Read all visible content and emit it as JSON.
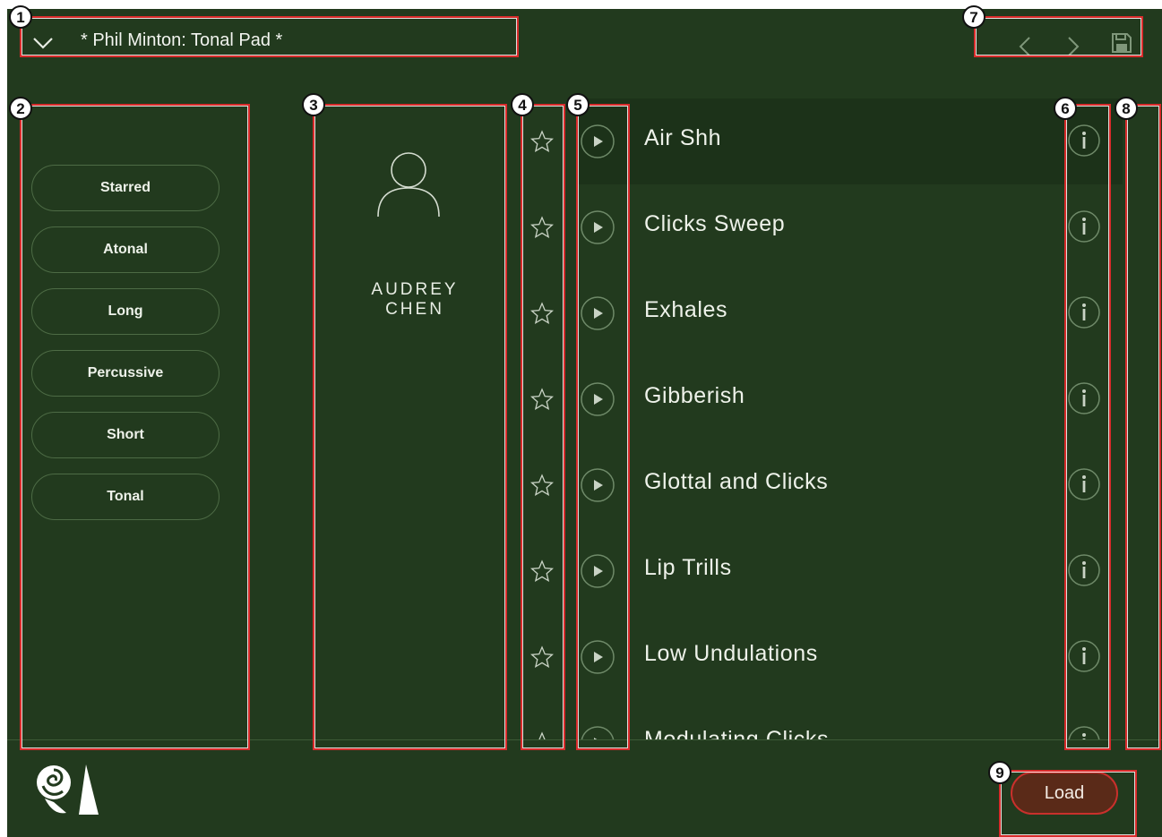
{
  "header": {
    "preset_title": "* Phil Minton: Tonal Pad *"
  },
  "tags": [
    "Starred",
    "Atonal",
    "Long",
    "Percussive",
    "Short",
    "Tonal"
  ],
  "author": {
    "line1": "AUDREY",
    "line2": "CHEN"
  },
  "presets": [
    {
      "name": "Air Shh",
      "selected": true
    },
    {
      "name": "Clicks Sweep",
      "selected": false
    },
    {
      "name": "Exhales",
      "selected": false
    },
    {
      "name": "Gibberish",
      "selected": false
    },
    {
      "name": "Glottal and Clicks",
      "selected": false
    },
    {
      "name": "Lip Trills",
      "selected": false
    },
    {
      "name": "Low Undulations",
      "selected": false
    },
    {
      "name": "Modulating Clicks",
      "selected": false
    }
  ],
  "footer": {
    "load_label": "Load"
  },
  "annotations": [
    "1",
    "2",
    "3",
    "4",
    "5",
    "6",
    "7",
    "8",
    "9"
  ],
  "colors": {
    "background": "#223a1e",
    "selected_row": "#1c3219",
    "pill_border": "#4d6b45",
    "load_fill": "#5a2a18",
    "annotation_box": "#d82b2b"
  },
  "icons": [
    "chevron-down-icon",
    "chevron-left-icon",
    "chevron-right-icon",
    "save-icon",
    "user-icon",
    "star-icon",
    "play-icon",
    "info-icon",
    "logo-icon"
  ]
}
